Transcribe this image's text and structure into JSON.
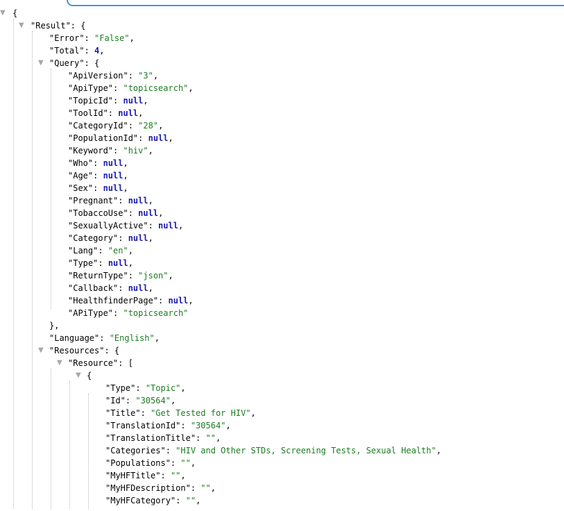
{
  "viewer": {
    "theme": {
      "key": "#000000",
      "string": "#1a7d21",
      "keyword": "#1b1cad",
      "guide": "#b8b8b8",
      "urlbar_focus": "#4a8ff0"
    },
    "icons": {
      "toggle": "triangle-down-icon"
    },
    "lines": [
      {
        "i": 0,
        "t": true,
        "tokens": [
          [
            "p",
            "{"
          ]
        ]
      },
      {
        "i": 1,
        "t": true,
        "tokens": [
          [
            "k",
            "\"Result\""
          ],
          [
            "p",
            ": {"
          ]
        ]
      },
      {
        "i": 2,
        "t": false,
        "tokens": [
          [
            "k",
            "\"Error\""
          ],
          [
            "p",
            ": "
          ],
          [
            "s",
            "\"False\""
          ],
          [
            "p",
            ","
          ]
        ]
      },
      {
        "i": 2,
        "t": false,
        "tokens": [
          [
            "k",
            "\"Total\""
          ],
          [
            "p",
            ": "
          ],
          [
            "n",
            "4"
          ],
          [
            "p",
            ","
          ]
        ]
      },
      {
        "i": 2,
        "t": true,
        "tokens": [
          [
            "k",
            "\"Query\""
          ],
          [
            "p",
            ": {"
          ]
        ]
      },
      {
        "i": 3,
        "t": false,
        "tokens": [
          [
            "k",
            "\"ApiVersion\""
          ],
          [
            "p",
            ": "
          ],
          [
            "s",
            "\"3\""
          ],
          [
            "p",
            ","
          ]
        ]
      },
      {
        "i": 3,
        "t": false,
        "tokens": [
          [
            "k",
            "\"ApiType\""
          ],
          [
            "p",
            ": "
          ],
          [
            "s",
            "\"topicsearch\""
          ],
          [
            "p",
            ","
          ]
        ]
      },
      {
        "i": 3,
        "t": false,
        "tokens": [
          [
            "k",
            "\"TopicId\""
          ],
          [
            "p",
            ": "
          ],
          [
            "nl",
            "null"
          ],
          [
            "p",
            ","
          ]
        ]
      },
      {
        "i": 3,
        "t": false,
        "tokens": [
          [
            "k",
            "\"ToolId\""
          ],
          [
            "p",
            ": "
          ],
          [
            "nl",
            "null"
          ],
          [
            "p",
            ","
          ]
        ]
      },
      {
        "i": 3,
        "t": false,
        "tokens": [
          [
            "k",
            "\"CategoryId\""
          ],
          [
            "p",
            ": "
          ],
          [
            "s",
            "\"28\""
          ],
          [
            "p",
            ","
          ]
        ]
      },
      {
        "i": 3,
        "t": false,
        "tokens": [
          [
            "k",
            "\"PopulationId\""
          ],
          [
            "p",
            ": "
          ],
          [
            "nl",
            "null"
          ],
          [
            "p",
            ","
          ]
        ]
      },
      {
        "i": 3,
        "t": false,
        "tokens": [
          [
            "k",
            "\"Keyword\""
          ],
          [
            "p",
            ": "
          ],
          [
            "s",
            "\"hiv\""
          ],
          [
            "p",
            ","
          ]
        ]
      },
      {
        "i": 3,
        "t": false,
        "tokens": [
          [
            "k",
            "\"Who\""
          ],
          [
            "p",
            ": "
          ],
          [
            "nl",
            "null"
          ],
          [
            "p",
            ","
          ]
        ]
      },
      {
        "i": 3,
        "t": false,
        "tokens": [
          [
            "k",
            "\"Age\""
          ],
          [
            "p",
            ": "
          ],
          [
            "nl",
            "null"
          ],
          [
            "p",
            ","
          ]
        ]
      },
      {
        "i": 3,
        "t": false,
        "tokens": [
          [
            "k",
            "\"Sex\""
          ],
          [
            "p",
            ": "
          ],
          [
            "nl",
            "null"
          ],
          [
            "p",
            ","
          ]
        ]
      },
      {
        "i": 3,
        "t": false,
        "tokens": [
          [
            "k",
            "\"Pregnant\""
          ],
          [
            "p",
            ": "
          ],
          [
            "nl",
            "null"
          ],
          [
            "p",
            ","
          ]
        ]
      },
      {
        "i": 3,
        "t": false,
        "tokens": [
          [
            "k",
            "\"TobaccoUse\""
          ],
          [
            "p",
            ": "
          ],
          [
            "nl",
            "null"
          ],
          [
            "p",
            ","
          ]
        ]
      },
      {
        "i": 3,
        "t": false,
        "tokens": [
          [
            "k",
            "\"SexuallyActive\""
          ],
          [
            "p",
            ": "
          ],
          [
            "nl",
            "null"
          ],
          [
            "p",
            ","
          ]
        ]
      },
      {
        "i": 3,
        "t": false,
        "tokens": [
          [
            "k",
            "\"Category\""
          ],
          [
            "p",
            ": "
          ],
          [
            "nl",
            "null"
          ],
          [
            "p",
            ","
          ]
        ]
      },
      {
        "i": 3,
        "t": false,
        "tokens": [
          [
            "k",
            "\"Lang\""
          ],
          [
            "p",
            ": "
          ],
          [
            "s",
            "\"en\""
          ],
          [
            "p",
            ","
          ]
        ]
      },
      {
        "i": 3,
        "t": false,
        "tokens": [
          [
            "k",
            "\"Type\""
          ],
          [
            "p",
            ": "
          ],
          [
            "nl",
            "null"
          ],
          [
            "p",
            ","
          ]
        ]
      },
      {
        "i": 3,
        "t": false,
        "tokens": [
          [
            "k",
            "\"ReturnType\""
          ],
          [
            "p",
            ": "
          ],
          [
            "s",
            "\"json\""
          ],
          [
            "p",
            ","
          ]
        ]
      },
      {
        "i": 3,
        "t": false,
        "tokens": [
          [
            "k",
            "\"Callback\""
          ],
          [
            "p",
            ": "
          ],
          [
            "nl",
            "null"
          ],
          [
            "p",
            ","
          ]
        ]
      },
      {
        "i": 3,
        "t": false,
        "tokens": [
          [
            "k",
            "\"HealthfinderPage\""
          ],
          [
            "p",
            ": "
          ],
          [
            "nl",
            "null"
          ],
          [
            "p",
            ","
          ]
        ]
      },
      {
        "i": 3,
        "t": false,
        "tokens": [
          [
            "k",
            "\"APiType\""
          ],
          [
            "p",
            ": "
          ],
          [
            "s",
            "\"topicsearch\""
          ]
        ]
      },
      {
        "i": 2,
        "t": false,
        "tokens": [
          [
            "p",
            "},"
          ]
        ]
      },
      {
        "i": 2,
        "t": false,
        "tokens": [
          [
            "k",
            "\"Language\""
          ],
          [
            "p",
            ": "
          ],
          [
            "s",
            "\"English\""
          ],
          [
            "p",
            ","
          ]
        ]
      },
      {
        "i": 2,
        "t": true,
        "tokens": [
          [
            "k",
            "\"Resources\""
          ],
          [
            "p",
            ": {"
          ]
        ]
      },
      {
        "i": 3,
        "t": true,
        "tokens": [
          [
            "k",
            "\"Resource\""
          ],
          [
            "p",
            ": ["
          ]
        ]
      },
      {
        "i": 4,
        "t": true,
        "tokens": [
          [
            "p",
            "{"
          ]
        ]
      },
      {
        "i": 5,
        "t": false,
        "tokens": [
          [
            "k",
            "\"Type\""
          ],
          [
            "p",
            ": "
          ],
          [
            "s",
            "\"Topic\""
          ],
          [
            "p",
            ","
          ]
        ]
      },
      {
        "i": 5,
        "t": false,
        "tokens": [
          [
            "k",
            "\"Id\""
          ],
          [
            "p",
            ": "
          ],
          [
            "s",
            "\"30564\""
          ],
          [
            "p",
            ","
          ]
        ]
      },
      {
        "i": 5,
        "t": false,
        "tokens": [
          [
            "k",
            "\"Title\""
          ],
          [
            "p",
            ": "
          ],
          [
            "s",
            "\"Get Tested for HIV\""
          ],
          [
            "p",
            ","
          ]
        ]
      },
      {
        "i": 5,
        "t": false,
        "tokens": [
          [
            "k",
            "\"TranslationId\""
          ],
          [
            "p",
            ": "
          ],
          [
            "s",
            "\"30564\""
          ],
          [
            "p",
            ","
          ]
        ]
      },
      {
        "i": 5,
        "t": false,
        "tokens": [
          [
            "k",
            "\"TranslationTitle\""
          ],
          [
            "p",
            ": "
          ],
          [
            "s",
            "\"\""
          ],
          [
            "p",
            ","
          ]
        ]
      },
      {
        "i": 5,
        "t": false,
        "tokens": [
          [
            "k",
            "\"Categories\""
          ],
          [
            "p",
            ": "
          ],
          [
            "s",
            "\"HIV and Other STDs, Screening Tests, Sexual Health\""
          ],
          [
            "p",
            ","
          ]
        ]
      },
      {
        "i": 5,
        "t": false,
        "tokens": [
          [
            "k",
            "\"Populations\""
          ],
          [
            "p",
            ": "
          ],
          [
            "s",
            "\"\""
          ],
          [
            "p",
            ","
          ]
        ]
      },
      {
        "i": 5,
        "t": false,
        "tokens": [
          [
            "k",
            "\"MyHFTitle\""
          ],
          [
            "p",
            ": "
          ],
          [
            "s",
            "\"\""
          ],
          [
            "p",
            ","
          ]
        ]
      },
      {
        "i": 5,
        "t": false,
        "tokens": [
          [
            "k",
            "\"MyHFDescription\""
          ],
          [
            "p",
            ": "
          ],
          [
            "s",
            "\"\""
          ],
          [
            "p",
            ","
          ]
        ]
      },
      {
        "i": 5,
        "t": false,
        "tokens": [
          [
            "k",
            "\"MyHFCategory\""
          ],
          [
            "p",
            ": "
          ],
          [
            "s",
            "\"\""
          ],
          [
            "p",
            ","
          ]
        ]
      }
    ]
  }
}
